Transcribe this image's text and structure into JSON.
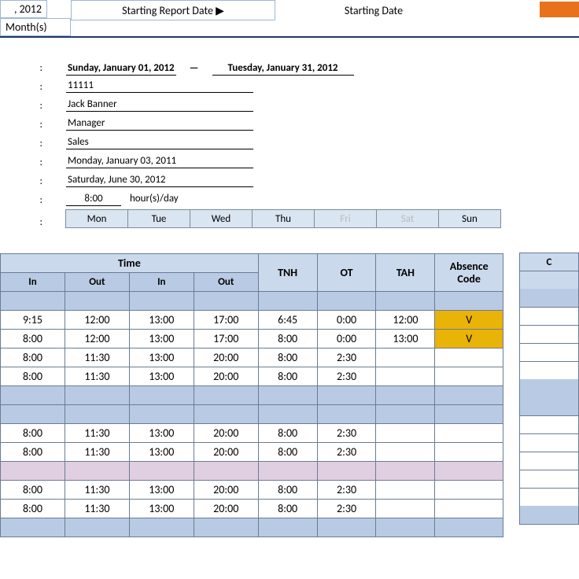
{
  "top": {
    "dateCell": ", 2012",
    "monthsCell": "Month(s)",
    "reportDate": "Starting Report Date ▶",
    "startingDate": "Starting Date"
  },
  "info": {
    "periodStart": "Sunday, January 01, 2012",
    "periodDash": "—",
    "periodEnd": "Tuesday, January 31, 2012",
    "empId": "11111",
    "empName": "Jack Banner",
    "title": "Manager",
    "dept": "Sales",
    "dateA": "Monday, January 03, 2011",
    "dateB": "Saturday, June 30, 2012",
    "hours": "8:00",
    "hoursUnit": "hour(s)/day"
  },
  "days": [
    "Mon",
    "Tue",
    "Wed",
    "Thu",
    "Fri",
    "Sat",
    "Sun"
  ],
  "daysDisabled": [
    false,
    false,
    false,
    false,
    true,
    true,
    false
  ],
  "headers": {
    "time": "Time",
    "in": "In",
    "out": "Out",
    "tnh": "TNH",
    "ot": "OT",
    "tah": "TAH",
    "absence": "Absence Code",
    "absence1": "Absence",
    "absence2": "Code",
    "sideCut": "C"
  },
  "rows": [
    {
      "cls": "blue",
      "in1": "",
      "out1": "",
      "in2": "",
      "out2": "",
      "tnh": "",
      "ot": "",
      "tah": "",
      "abs": ""
    },
    {
      "cls": "white",
      "in1": "9:15",
      "out1": "12:00",
      "in2": "13:00",
      "out2": "17:00",
      "tnh": "6:45",
      "ot": "0:00",
      "tah": "12:00",
      "abs": "V",
      "absHl": true
    },
    {
      "cls": "white",
      "in1": "8:00",
      "out1": "12:00",
      "in2": "13:00",
      "out2": "17:00",
      "tnh": "8:00",
      "ot": "0:00",
      "tah": "13:00",
      "abs": "V",
      "absHl": true
    },
    {
      "cls": "white",
      "in1": "8:00",
      "out1": "11:30",
      "in2": "13:00",
      "out2": "20:00",
      "tnh": "8:00",
      "ot": "2:30",
      "tah": "",
      "abs": ""
    },
    {
      "cls": "white",
      "in1": "8:00",
      "out1": "11:30",
      "in2": "13:00",
      "out2": "20:00",
      "tnh": "8:00",
      "ot": "2:30",
      "tah": "",
      "abs": ""
    },
    {
      "cls": "blue",
      "in1": "",
      "out1": "",
      "in2": "",
      "out2": "",
      "tnh": "",
      "ot": "",
      "tah": "",
      "abs": ""
    },
    {
      "cls": "blue",
      "in1": "",
      "out1": "",
      "in2": "",
      "out2": "",
      "tnh": "",
      "ot": "",
      "tah": "",
      "abs": ""
    },
    {
      "cls": "white",
      "in1": "8:00",
      "out1": "11:30",
      "in2": "13:00",
      "out2": "20:00",
      "tnh": "8:00",
      "ot": "2:30",
      "tah": "",
      "abs": ""
    },
    {
      "cls": "white",
      "in1": "8:00",
      "out1": "11:30",
      "in2": "13:00",
      "out2": "20:00",
      "tnh": "8:00",
      "ot": "2:30",
      "tah": "",
      "abs": ""
    },
    {
      "cls": "pink",
      "in1": "",
      "out1": "",
      "in2": "",
      "out2": "",
      "tnh": "",
      "ot": "",
      "tah": "",
      "abs": ""
    },
    {
      "cls": "white",
      "in1": "8:00",
      "out1": "11:30",
      "in2": "13:00",
      "out2": "20:00",
      "tnh": "8:00",
      "ot": "2:30",
      "tah": "",
      "abs": ""
    },
    {
      "cls": "white",
      "in1": "8:00",
      "out1": "11:30",
      "in2": "13:00",
      "out2": "20:00",
      "tnh": "8:00",
      "ot": "2:30",
      "tah": "",
      "abs": ""
    },
    {
      "cls": "blue",
      "in1": "",
      "out1": "",
      "in2": "",
      "out2": "",
      "tnh": "",
      "ot": "",
      "tah": "",
      "abs": ""
    }
  ]
}
